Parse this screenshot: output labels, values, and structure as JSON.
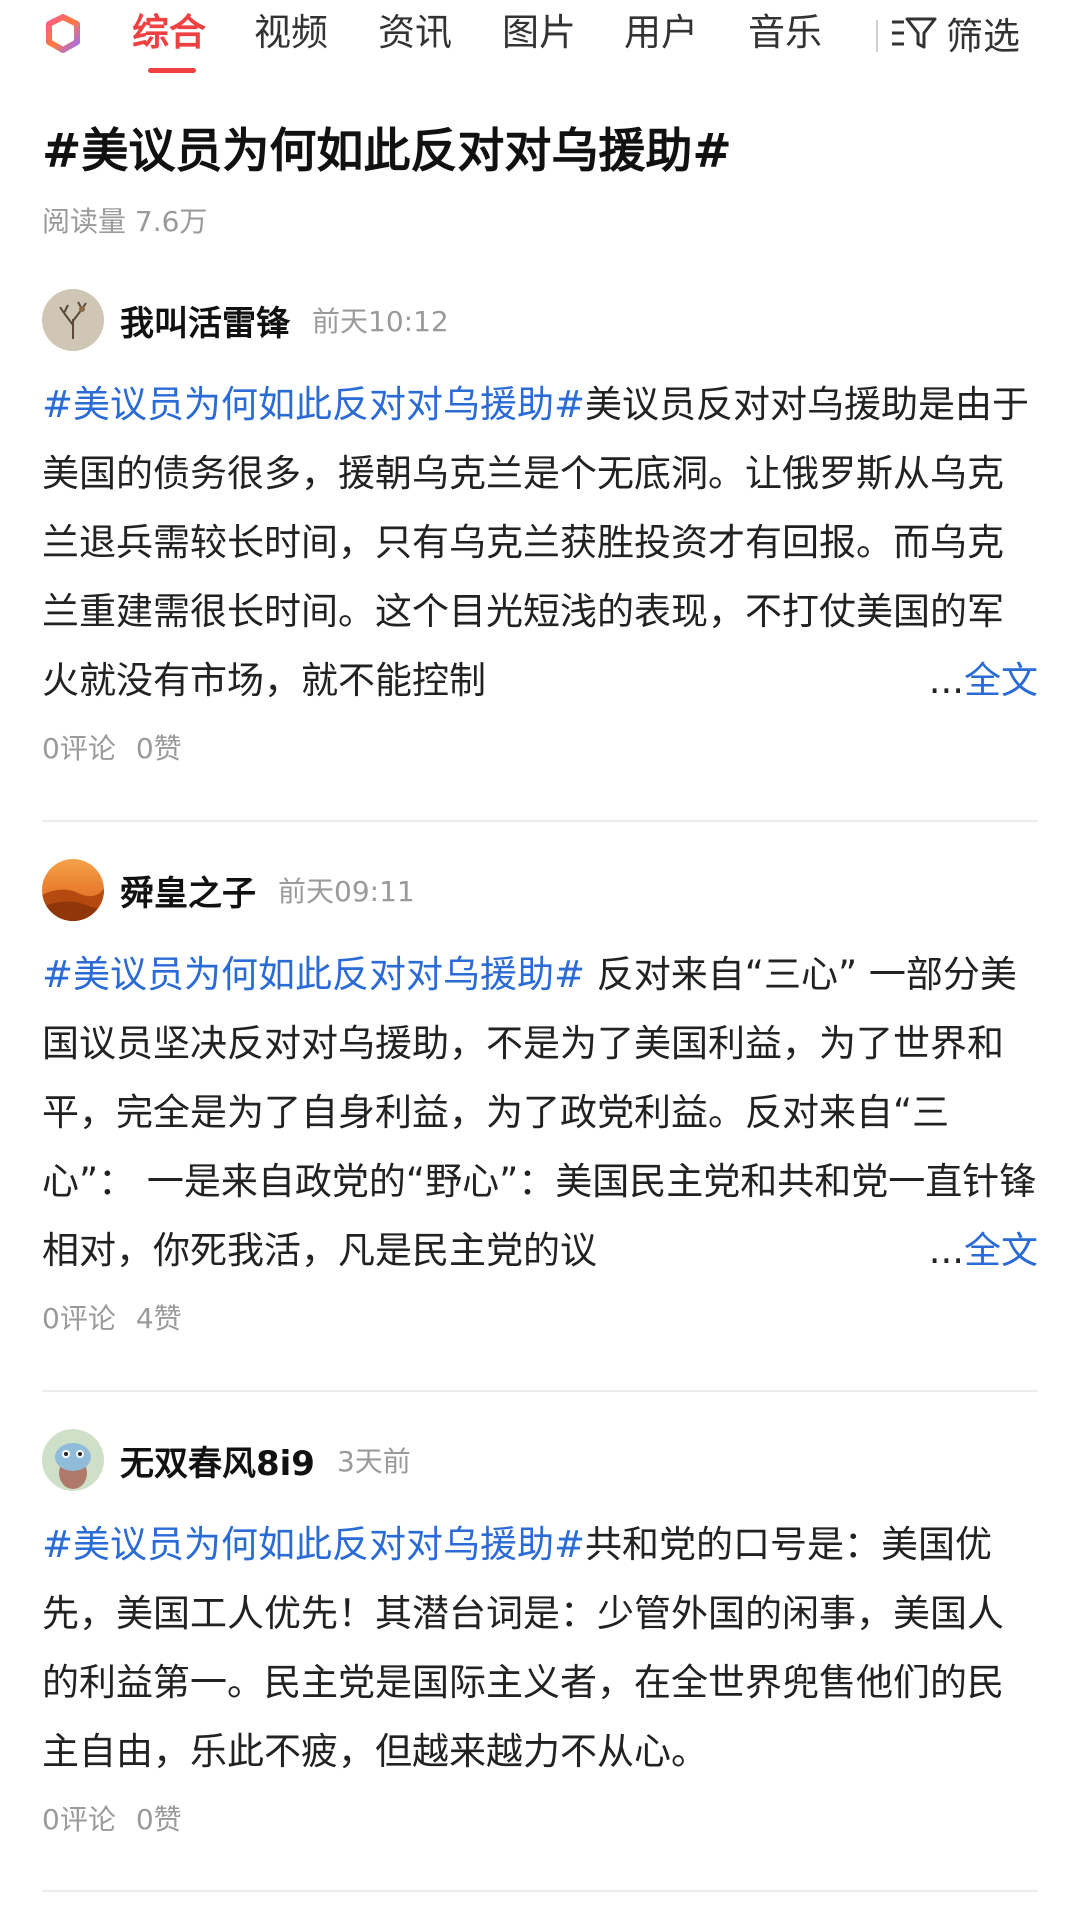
{
  "tabs": [
    {
      "label": "综合",
      "active": true
    },
    {
      "label": "视频",
      "active": false
    },
    {
      "label": "资讯",
      "active": false
    },
    {
      "label": "图片",
      "active": false
    },
    {
      "label": "用户",
      "active": false
    },
    {
      "label": "音乐",
      "active": false
    }
  ],
  "filter": {
    "label": "筛选",
    "icon": "filter-icon"
  },
  "topic": {
    "title": "#美议员为何如此反对对乌援助#",
    "reads": "阅读量 7.6万"
  },
  "posts": [
    {
      "username": "我叫活雷锋",
      "time": "前天10:12",
      "avatar": "tree-sketch-avatar",
      "hashtag": "#美议员为何如此反对对乌援助#",
      "text": "美议员反对对乌援助是由于美国的债务很多，援朝乌克兰是个无底洞。让俄罗斯从乌克兰退兵需较长时间，只有乌克兰获胜投资才有回报。而乌克兰重建需很长时间。这个目光短浅的表现，不打仗美国的军火就没有市场，就不能控制",
      "more_dots": "...",
      "more_label": "全文",
      "comments": "0评论",
      "likes": "0赞"
    },
    {
      "username": "舜皇之子",
      "time": "前天09:11",
      "avatar": "desert-sunset-avatar",
      "hashtag": "#美议员为何如此反对对乌援助#",
      "text": " 反对来自“三心” 一部分美国议员坚决反对对乌援助，不是为了美国利益，为了世界和平，完全是为了自身利益，为了政党利益。反对来自“三心”： 一是来自政党的“野心”：美国民主党和共和党一直针锋相对，你死我活，凡是民主党的议",
      "more_dots": "...",
      "more_label": "全文",
      "comments": "0评论",
      "likes": "4赞"
    },
    {
      "username": "无双春风8i9",
      "time": "3天前",
      "avatar": "cartoon-creature-avatar",
      "hashtag": "#美议员为何如此反对对乌援助#",
      "text": "共和党的口号是：美国优先，美国工人优先！其潜台词是：少管外国的闲事，美国人的利益第一。民主党是国际主义者，在全世界兜售他们的民主自由，乐此不疲，但越来越力不从心。",
      "comments": "0评论",
      "likes": "0赞"
    }
  ],
  "colors": {
    "accent": "#f04142",
    "hashtag": "#2a6bd6",
    "meta": "#9a9a9a"
  }
}
